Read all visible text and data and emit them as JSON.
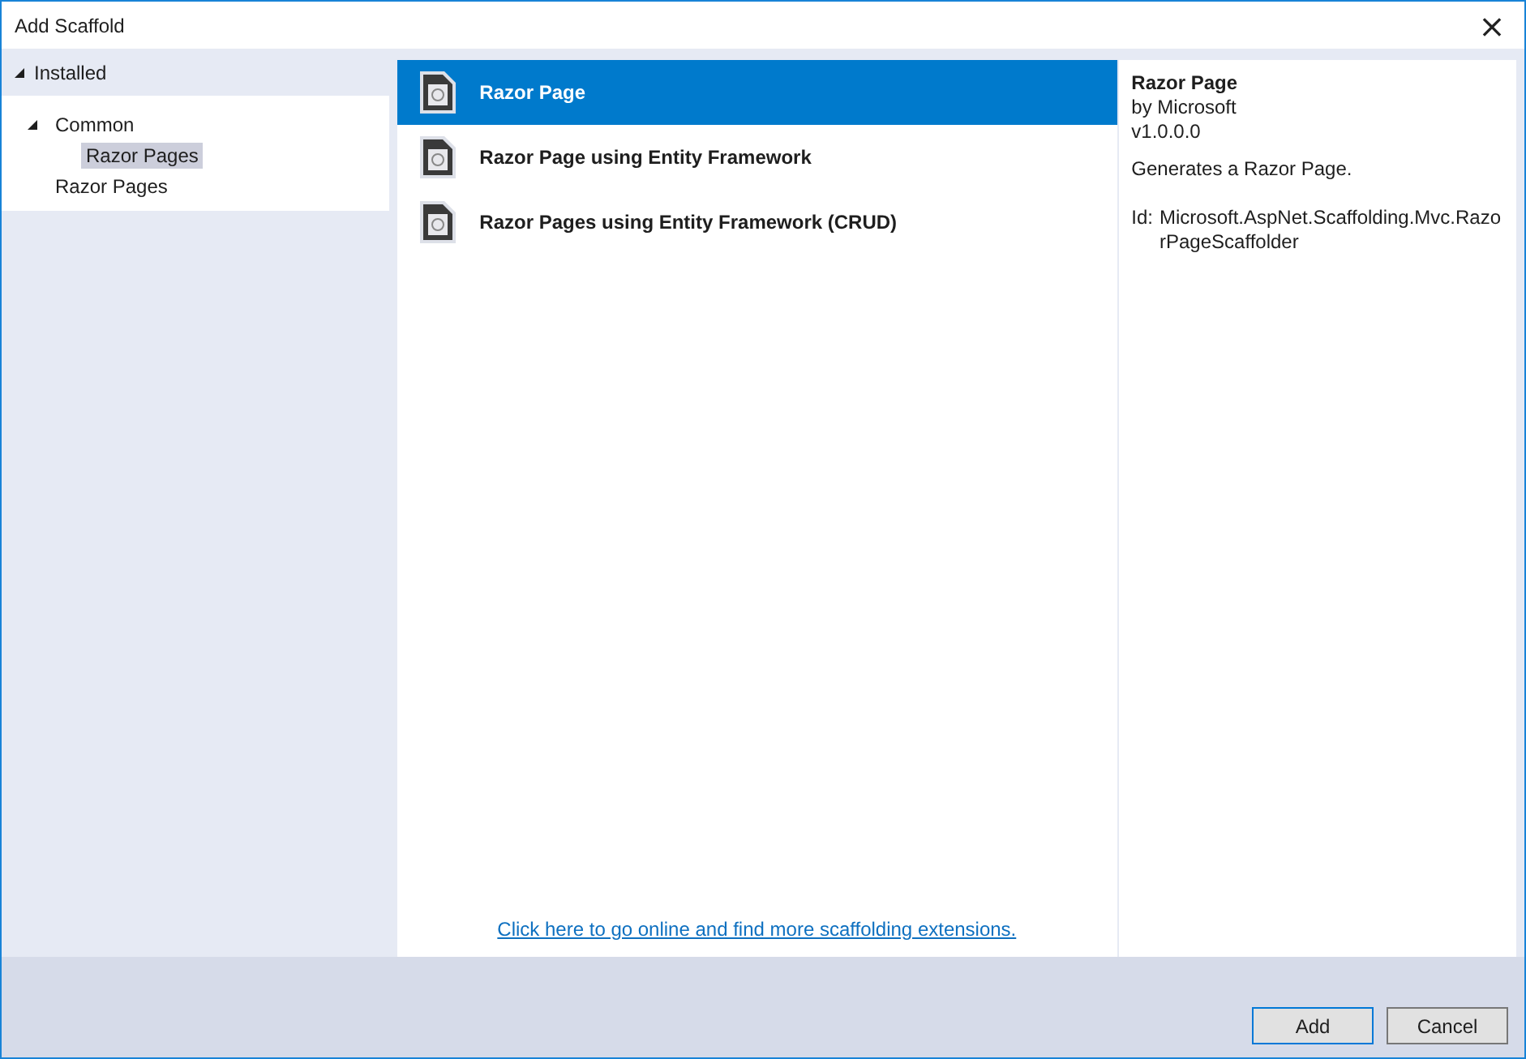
{
  "window": {
    "title": "Add Scaffold",
    "close": "×"
  },
  "installed": {
    "label": "Installed",
    "expanded": true
  },
  "tree": [
    {
      "label": "Common",
      "expanded": true,
      "selected": false,
      "children": [
        {
          "label": "Razor Pages",
          "selected": true
        }
      ]
    },
    {
      "label": "Razor Pages",
      "selected": false
    }
  ],
  "templates": [
    {
      "name": "Razor Page",
      "selected": true
    },
    {
      "name": "Razor Page using Entity Framework",
      "selected": false
    },
    {
      "name": "Razor Pages using Entity Framework (CRUD)",
      "selected": false
    }
  ],
  "online_link": "Click here to go online and find more scaffolding extensions.",
  "details": {
    "title": "Razor Page",
    "author": "by Microsoft",
    "version": "v1.0.0.0",
    "description": "Generates a Razor Page.",
    "id_label": "Id:",
    "id_value": "Microsoft.AspNet.Scaffolding.Mvc.RazorPageScaffolder"
  },
  "buttons": [
    {
      "label": "Add",
      "default": true
    },
    {
      "label": "Cancel",
      "default": false
    }
  ]
}
